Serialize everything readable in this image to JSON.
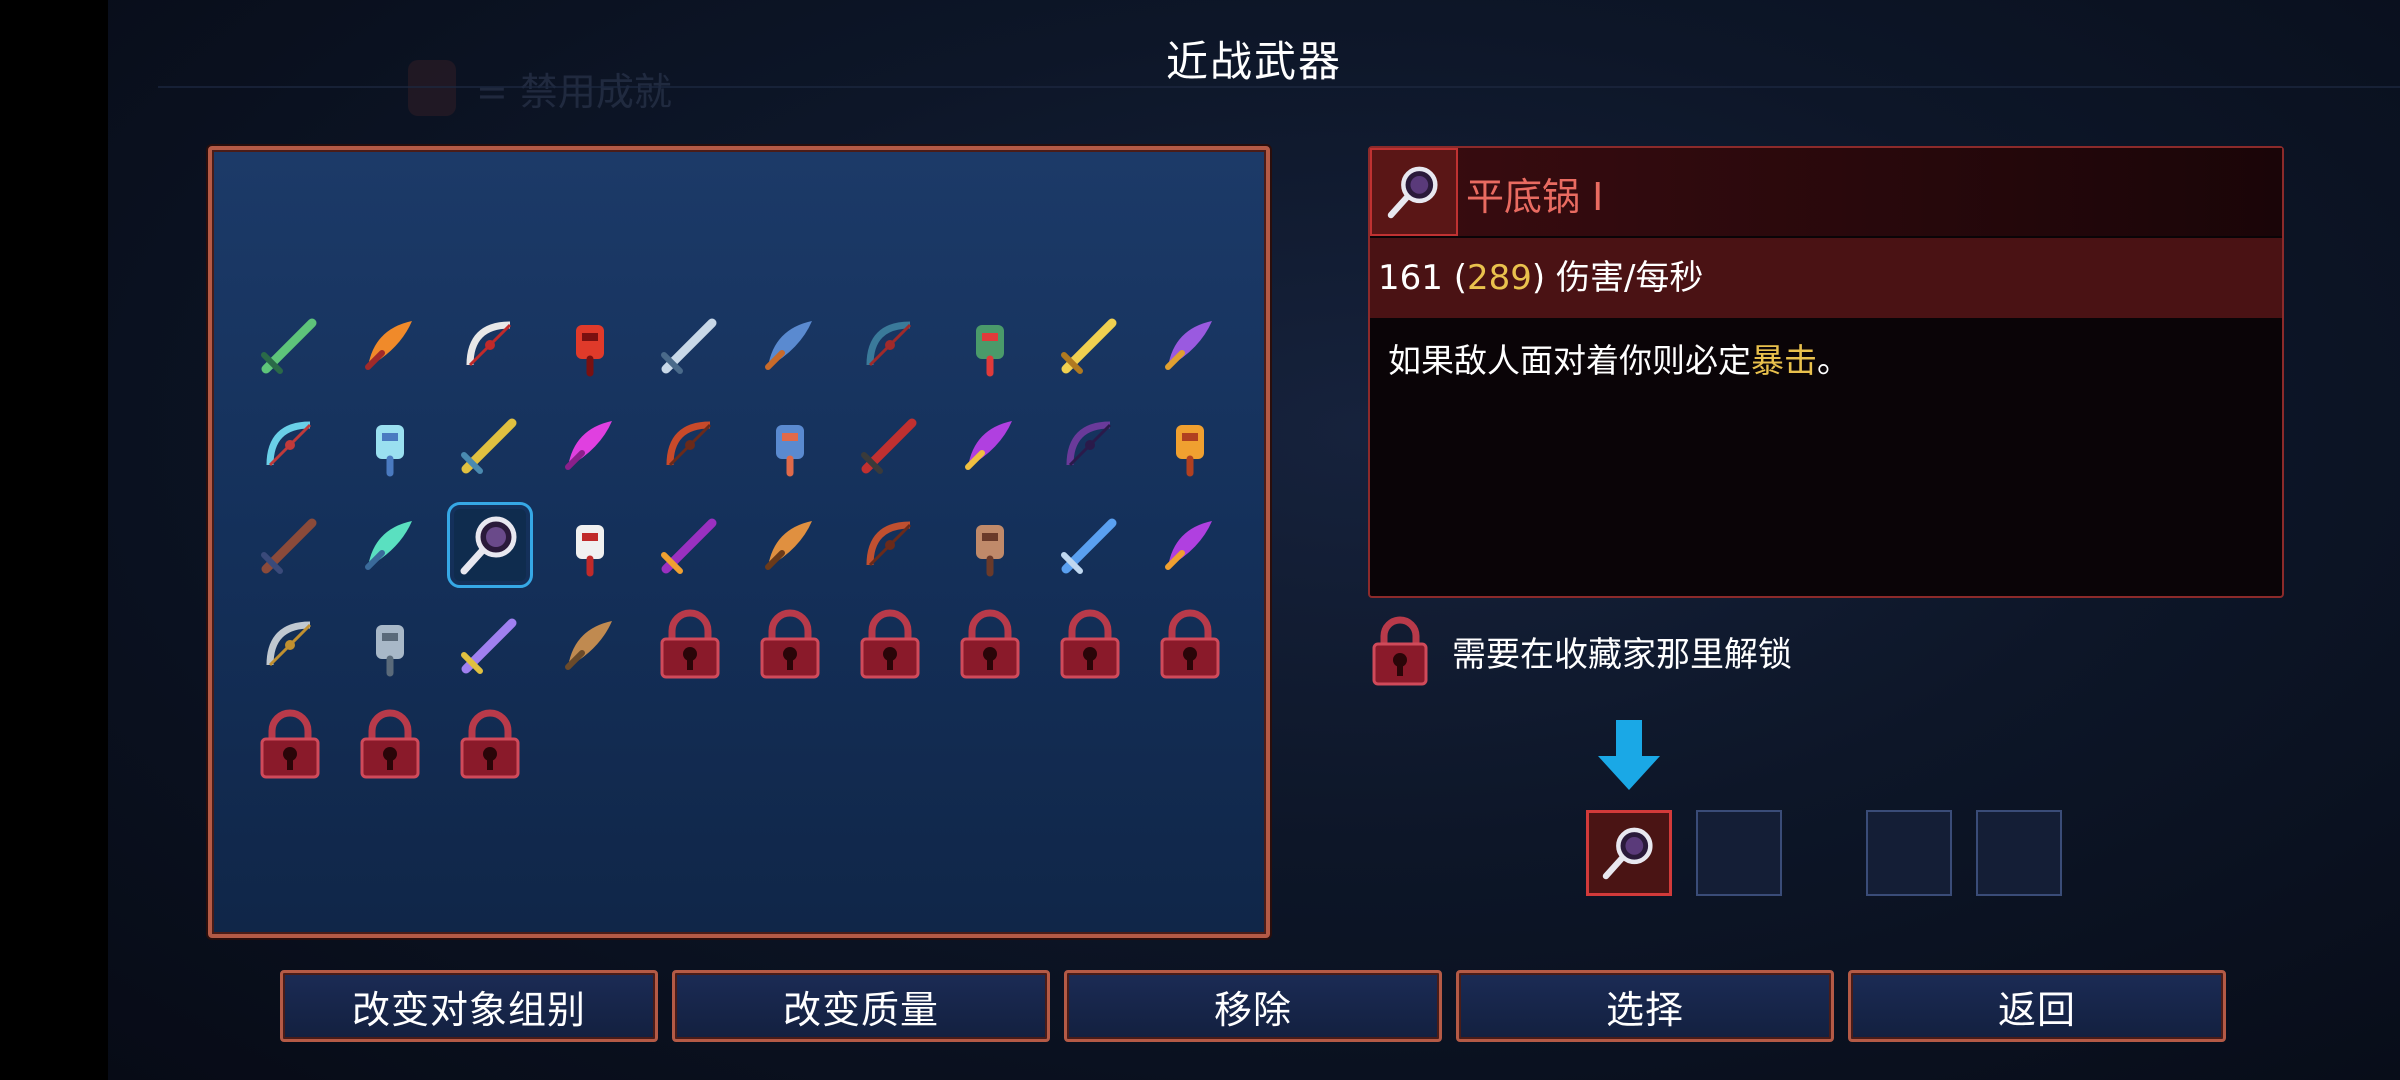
{
  "screen_title": "近战武器",
  "ghost_label": "= 禁用成就",
  "grid": {
    "items": [
      {
        "icon": "feather-dagger-icon",
        "locked": false,
        "c1": "#5ec47a",
        "c2": "#2a6a48"
      },
      {
        "icon": "flame-dagger-icon",
        "locked": false,
        "c1": "#f08a2a",
        "c2": "#a02a2a"
      },
      {
        "icon": "bloody-cleaver-icon",
        "locked": false,
        "c1": "#e8e8e8",
        "c2": "#c02a2a"
      },
      {
        "icon": "red-whip-icon",
        "locked": false,
        "c1": "#e03a2a",
        "c2": "#7a1010"
      },
      {
        "icon": "crossed-swords-icon",
        "locked": false,
        "c1": "#c8d8e8",
        "c2": "#4a6a8a"
      },
      {
        "icon": "blue-shovel-icon",
        "locked": false,
        "c1": "#5a8ad0",
        "c2": "#c86a2a"
      },
      {
        "icon": "dark-spear-icon",
        "locked": false,
        "c1": "#3a7a9a",
        "c2": "#a02a2a"
      },
      {
        "icon": "beetle-blade-icon",
        "locked": false,
        "c1": "#4a9a6a",
        "c2": "#e03a3a"
      },
      {
        "icon": "golden-sword-icon",
        "locked": false,
        "c1": "#f0d050",
        "c2": "#b07a20"
      },
      {
        "icon": "purple-trident-icon",
        "locked": false,
        "c1": "#9a5ae0",
        "c2": "#e0a030"
      },
      {
        "icon": "ice-bow-icon",
        "locked": false,
        "c1": "#6ad0e8",
        "c2": "#c03a3a"
      },
      {
        "icon": "frost-arrow-icon",
        "locked": false,
        "c1": "#9ae0f0",
        "c2": "#4a7ac0"
      },
      {
        "icon": "golden-crossbow-icon",
        "locked": false,
        "c1": "#e0c040",
        "c2": "#4a8ab0"
      },
      {
        "icon": "magenta-bow-icon",
        "locked": false,
        "c1": "#e040e0",
        "c2": "#8a208a"
      },
      {
        "icon": "round-shield-icon",
        "locked": false,
        "c1": "#c84a2a",
        "c2": "#6a2a1a"
      },
      {
        "icon": "boot-icon",
        "locked": false,
        "c1": "#5a8ad0",
        "c2": "#e06a4a"
      },
      {
        "icon": "helmet-icon",
        "locked": false,
        "c1": "#c03030",
        "c2": "#3a3a3a"
      },
      {
        "icon": "purple-goblet-icon",
        "locked": false,
        "c1": "#b040e0",
        "c2": "#f0c040"
      },
      {
        "icon": "shadow-whip-icon",
        "locked": false,
        "c1": "#6a3a9a",
        "c2": "#2a1a4a"
      },
      {
        "icon": "fire-torch-icon",
        "locked": false,
        "c1": "#f0a030",
        "c2": "#b04020"
      },
      {
        "icon": "dark-bow-icon",
        "locked": false,
        "c1": "#8a4a3a",
        "c2": "#3a4a7a"
      },
      {
        "icon": "crystal-spear-icon",
        "locked": false,
        "c1": "#5ae0c0",
        "c2": "#3a6a9a"
      },
      {
        "icon": "frying-pan-icon",
        "locked": false,
        "c1": "#e8e8f0",
        "c2": "#6a4a8a",
        "selected": true
      },
      {
        "icon": "spiked-shield-icon",
        "locked": false,
        "c1": "#f0f0f0",
        "c2": "#c02a2a"
      },
      {
        "icon": "purple-scythe-icon",
        "locked": false,
        "c1": "#9a30c0",
        "c2": "#f0a030"
      },
      {
        "icon": "lute-icon",
        "locked": false,
        "c1": "#e09040",
        "c2": "#6a3a1a"
      },
      {
        "icon": "cane-icon",
        "locked": false,
        "c1": "#c05030",
        "c2": "#6a2a1a"
      },
      {
        "icon": "claw-glove-icon",
        "locked": false,
        "c1": "#c08a6a",
        "c2": "#6a3a2a"
      },
      {
        "icon": "blue-rapier-icon",
        "locked": false,
        "c1": "#5aa0f0",
        "c2": "#c0d8f0"
      },
      {
        "icon": "purple-lantern-icon",
        "locked": false,
        "c1": "#b040e0",
        "c2": "#f0a030"
      },
      {
        "icon": "katana-icon",
        "locked": false,
        "c1": "#c0c8d0",
        "c2": "#c09030"
      },
      {
        "icon": "tombstone-icon",
        "locked": false,
        "c1": "#a8b8c8",
        "c2": "#5a6a7a"
      },
      {
        "icon": "war-hammer-icon",
        "locked": false,
        "c1": "#a080f0",
        "c2": "#e0c040"
      },
      {
        "icon": "wooden-club-icon",
        "locked": false,
        "c1": "#c08a50",
        "c2": "#6a4a2a"
      },
      {
        "icon": "lock-icon",
        "locked": true
      },
      {
        "icon": "lock-icon",
        "locked": true
      },
      {
        "icon": "lock-icon",
        "locked": true
      },
      {
        "icon": "lock-icon",
        "locked": true
      },
      {
        "icon": "lock-icon",
        "locked": true
      },
      {
        "icon": "lock-icon",
        "locked": true
      },
      {
        "icon": "lock-icon",
        "locked": true
      },
      {
        "icon": "lock-icon",
        "locked": true
      },
      {
        "icon": "lock-icon",
        "locked": true
      }
    ]
  },
  "detail": {
    "name": "平底锅 I",
    "dps_base": "161",
    "dps_open": "(",
    "dps_bonus": "289",
    "dps_close": ")",
    "dps_label": "伤害/每秒",
    "desc_prefix": "如果敌人面对着你则必定",
    "desc_keyword": "暴击",
    "desc_suffix": "。"
  },
  "unlock_note": "需要在收藏家那里解锁",
  "buttons": {
    "change_group": "改变对象组别",
    "change_quality": "改变质量",
    "remove": "移除",
    "select": "选择",
    "back": "返回"
  },
  "colors": {
    "accent_gold": "#e9c14d",
    "name_red": "#e96b61",
    "frame": "#b45a46",
    "cursor": "#36a8e6"
  }
}
